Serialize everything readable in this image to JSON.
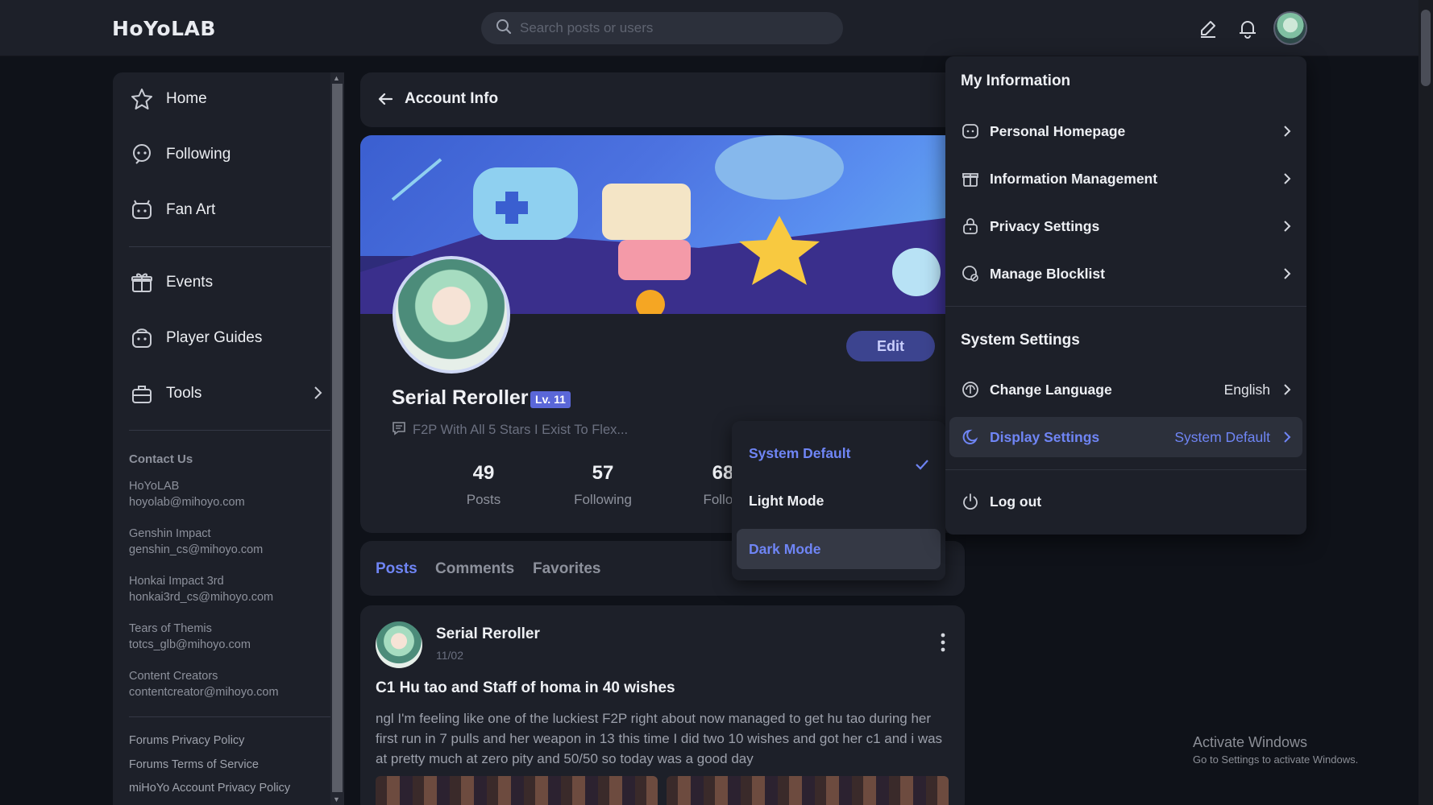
{
  "topbar": {
    "logo": "HoYoLAB",
    "search_placeholder": "Search posts or users"
  },
  "sidebar": {
    "items": [
      {
        "label": "Home"
      },
      {
        "label": "Following"
      },
      {
        "label": "Fan Art"
      },
      {
        "label": "Events"
      },
      {
        "label": "Player Guides"
      },
      {
        "label": "Tools"
      }
    ],
    "contact_title": "Contact Us",
    "contacts": [
      {
        "name": "HoYoLAB",
        "email": "hoyolab@mihoyo.com"
      },
      {
        "name": "Genshin Impact",
        "email": "genshin_cs@mihoyo.com"
      },
      {
        "name": "Honkai Impact 3rd",
        "email": "honkai3rd_cs@mihoyo.com"
      },
      {
        "name": "Tears of Themis",
        "email": "totcs_glb@mihoyo.com"
      },
      {
        "name": "Content Creators",
        "email": "contentcreator@mihoyo.com"
      }
    ],
    "footer_links": [
      "Forums Privacy Policy",
      "Forums Terms of Service",
      "miHoYo Account Privacy Policy"
    ]
  },
  "account": {
    "header_title": "Account Info",
    "edit_label": "Edit",
    "username": "Serial Reroller",
    "level": "Lv. 11",
    "bio": "F2P With All 5 Stars I Exist To Flex...",
    "stats": [
      {
        "num": "49",
        "label": "Posts"
      },
      {
        "num": "57",
        "label": "Following"
      },
      {
        "num": "68",
        "label": "Follow"
      }
    ]
  },
  "tabs": [
    "Posts",
    "Comments",
    "Favorites"
  ],
  "post": {
    "author": "Serial Reroller",
    "date": "11/02",
    "title": "C1 Hu tao and Staff of homa in 40 wishes",
    "body": "ngl I'm feeling like one of the luckiest F2P right about now managed to get hu tao during her first run in 7 pulls and her weapon in 13 this time I did two 10 wishes and got her c1 and i was at pretty much at zero pity and 50/50 so today was a good day"
  },
  "display_menu": {
    "options": [
      "System Default",
      "Light Mode",
      "Dark Mode"
    ],
    "selected": "System Default"
  },
  "user_menu": {
    "my_info_title": "My Information",
    "my_info_items": [
      "Personal Homepage",
      "Information Management",
      "Privacy Settings",
      "Manage Blocklist"
    ],
    "system_title": "System Settings",
    "language_label": "Change Language",
    "language_value": "English",
    "display_label": "Display Settings",
    "display_value": "System Default",
    "logout_label": "Log out"
  },
  "watermark": {
    "line1": "Activate Windows",
    "line2": "Go to Settings to activate Windows."
  },
  "colors": {
    "accent": "#6f85f5",
    "surface": "#1d2029",
    "background": "#0f1219"
  }
}
